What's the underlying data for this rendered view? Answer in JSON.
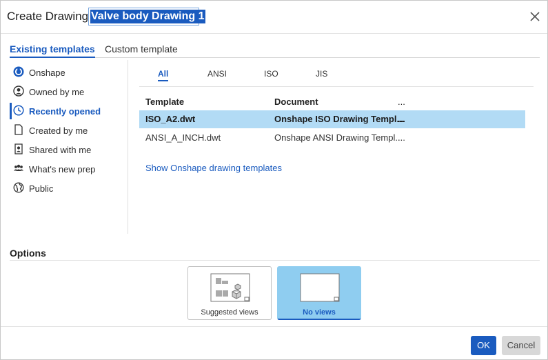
{
  "dialog": {
    "title_label": "Create Drawing:",
    "name_value": "Valve body Drawing 1"
  },
  "tabs": [
    {
      "label": "Existing templates",
      "active": true
    },
    {
      "label": "Custom template",
      "active": false
    }
  ],
  "sidebar": {
    "items": [
      {
        "label": "Onshape",
        "icon": "onshape-logo-icon"
      },
      {
        "label": "Owned by me",
        "icon": "user-icon"
      },
      {
        "label": "Recently opened",
        "icon": "clock-icon",
        "active": true
      },
      {
        "label": "Created by me",
        "icon": "document-icon"
      },
      {
        "label": "Shared with me",
        "icon": "shared-user-icon"
      },
      {
        "label": "What's new prep",
        "icon": "team-icon"
      },
      {
        "label": "Public",
        "icon": "globe-icon"
      }
    ]
  },
  "filters": [
    {
      "label": "All",
      "active": true
    },
    {
      "label": "ANSI"
    },
    {
      "label": "ISO"
    },
    {
      "label": "JIS"
    }
  ],
  "table": {
    "headers": [
      "Template",
      "Document",
      "..."
    ],
    "rows": [
      {
        "template": "ISO_A2.dwt",
        "document": "Onshape ISO Drawing Templ...",
        "more": "...",
        "selected": true
      },
      {
        "template": "ANSI_A_INCH.dwt",
        "document": "Onshape ANSI Drawing Templ...",
        "more": "..."
      }
    ]
  },
  "link": "Show Onshape drawing templates",
  "options": {
    "header": "Options",
    "cards": [
      {
        "label": "Suggested views"
      },
      {
        "label": "No views",
        "selected": true
      }
    ]
  },
  "buttons": {
    "ok": "OK",
    "cancel": "Cancel"
  },
  "colors": {
    "accent": "#1a5bbf",
    "selected_row": "#b2dbf5",
    "selected_card": "#8fcdf0"
  }
}
